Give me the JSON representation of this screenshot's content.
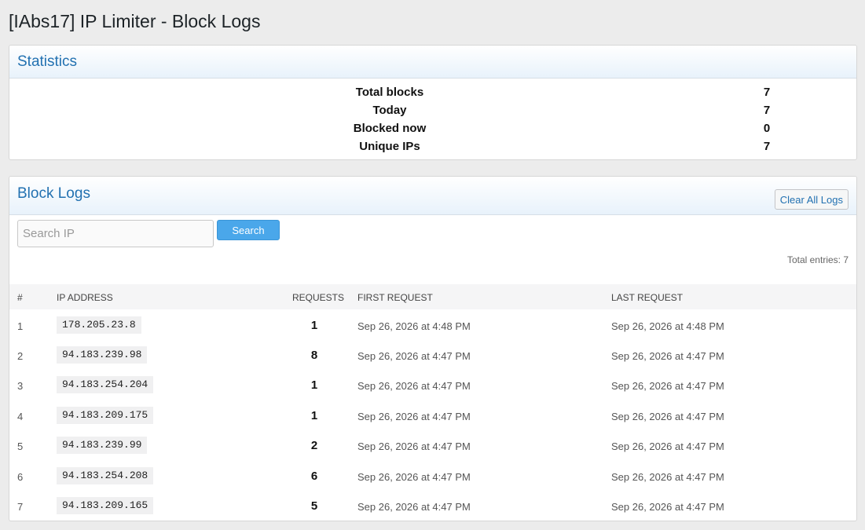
{
  "page": {
    "title": "[IAbs17] IP Limiter - Block Logs"
  },
  "statistics": {
    "title": "Statistics",
    "rows": [
      {
        "label": "Total blocks",
        "value": "7"
      },
      {
        "label": "Today",
        "value": "7"
      },
      {
        "label": "Blocked now",
        "value": "0"
      },
      {
        "label": "Unique IPs",
        "value": "7"
      }
    ]
  },
  "block_logs": {
    "title": "Block Logs",
    "clear_label": "Clear All Logs",
    "search_placeholder": "Search IP",
    "search_value": "",
    "search_label": "Search",
    "total_entries": "Total entries: 7",
    "columns": [
      "#",
      "IP ADDRESS",
      "REQUESTS",
      "FIRST REQUEST",
      "LAST REQUEST"
    ],
    "rows": [
      {
        "num": "1",
        "ip": "178.205.23.8",
        "requests": "1",
        "first": "Sep 26, 2026 at 4:48 PM",
        "last": "Sep 26, 2026 at 4:48 PM"
      },
      {
        "num": "2",
        "ip": "94.183.239.98",
        "requests": "8",
        "first": "Sep 26, 2026 at 4:47 PM",
        "last": "Sep 26, 2026 at 4:47 PM"
      },
      {
        "num": "3",
        "ip": "94.183.254.204",
        "requests": "1",
        "first": "Sep 26, 2026 at 4:47 PM",
        "last": "Sep 26, 2026 at 4:47 PM"
      },
      {
        "num": "4",
        "ip": "94.183.209.175",
        "requests": "1",
        "first": "Sep 26, 2026 at 4:47 PM",
        "last": "Sep 26, 2026 at 4:47 PM"
      },
      {
        "num": "5",
        "ip": "94.183.239.99",
        "requests": "2",
        "first": "Sep 26, 2026 at 4:47 PM",
        "last": "Sep 26, 2026 at 4:47 PM"
      },
      {
        "num": "6",
        "ip": "94.183.254.208",
        "requests": "6",
        "first": "Sep 26, 2026 at 4:47 PM",
        "last": "Sep 26, 2026 at 4:47 PM"
      },
      {
        "num": "7",
        "ip": "94.183.209.165",
        "requests": "5",
        "first": "Sep 26, 2026 at 4:47 PM",
        "last": "Sep 26, 2026 at 4:47 PM"
      }
    ]
  },
  "colors": {
    "accent": "#2271b1",
    "button": "#4aa7ea",
    "background": "#ececec"
  }
}
